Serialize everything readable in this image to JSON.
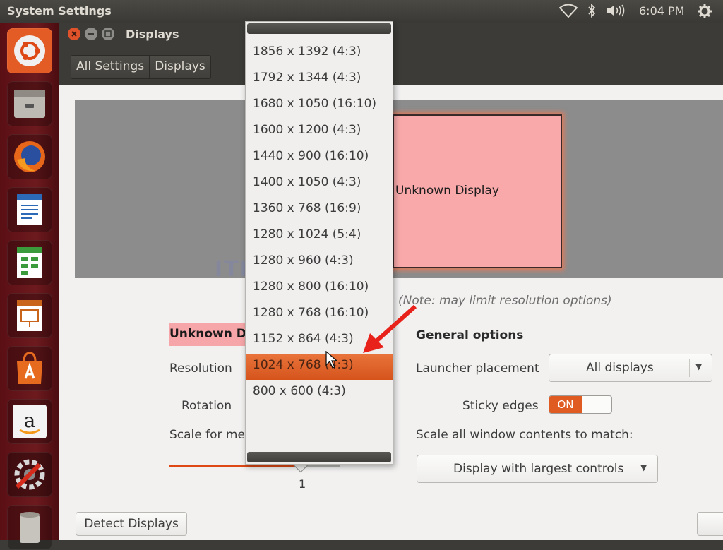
{
  "panel": {
    "app_title": "System Settings",
    "clock": "6:04 PM",
    "icons": [
      "wifi-icon",
      "bluetooth-icon",
      "volume-icon",
      "gear-icon"
    ]
  },
  "launcher": {
    "items": [
      "ubuntu-logo-icon",
      "files-icon",
      "firefox-icon",
      "writer-icon",
      "calc-icon",
      "impress-icon",
      "software-center-icon",
      "amazon-icon",
      "system-settings-icon",
      "trash-icon"
    ]
  },
  "window": {
    "title": "Displays",
    "breadcrumb": [
      "All Settings",
      "Displays"
    ]
  },
  "preview": {
    "monitor_label": "Unknown Display",
    "watermark": "ITF . . s Blog"
  },
  "note": "(Note: may limit resolution options)",
  "display_section": {
    "name": "Unknown Di",
    "resolution_label": "Resolution",
    "rotation_label": "Rotation",
    "scale_label": "Scale for me",
    "scale_value": "1",
    "scale_level": 0.78
  },
  "general_options": {
    "heading": "General options",
    "launcher_placement_label": "Launcher placement",
    "launcher_placement_value": "All displays",
    "sticky_edges_label": "Sticky edges",
    "sticky_edges_state": "ON",
    "scale_all_label": "Scale all window contents to match:",
    "scale_all_value": "Display with largest controls"
  },
  "buttons": {
    "detect_displays": "Detect Displays"
  },
  "resolution_dropdown": {
    "options": [
      "1856 x 1392 (4:3)",
      "1792 x 1344 (4:3)",
      "1680 x 1050 (16:10)",
      "1600 x 1200 (4:3)",
      "1440 x 900 (16:10)",
      "1400 x 1050 (4:3)",
      "1360 x 768 (16:9)",
      "1280 x 1024 (5:4)",
      "1280 x 960 (4:3)",
      "1280 x 800 (16:10)",
      "1280 x 768 (16:10)",
      "1152 x 864 (4:3)",
      "1024 x 768 (4:3)",
      "800 x 600 (4:3)"
    ],
    "selected": "1024 x 768 (4:3)"
  },
  "colors": {
    "accent": "#dd4814",
    "highlight": "#e9743b",
    "display_pink": "#f9a9aa",
    "arrow_red": "#e8221b"
  }
}
